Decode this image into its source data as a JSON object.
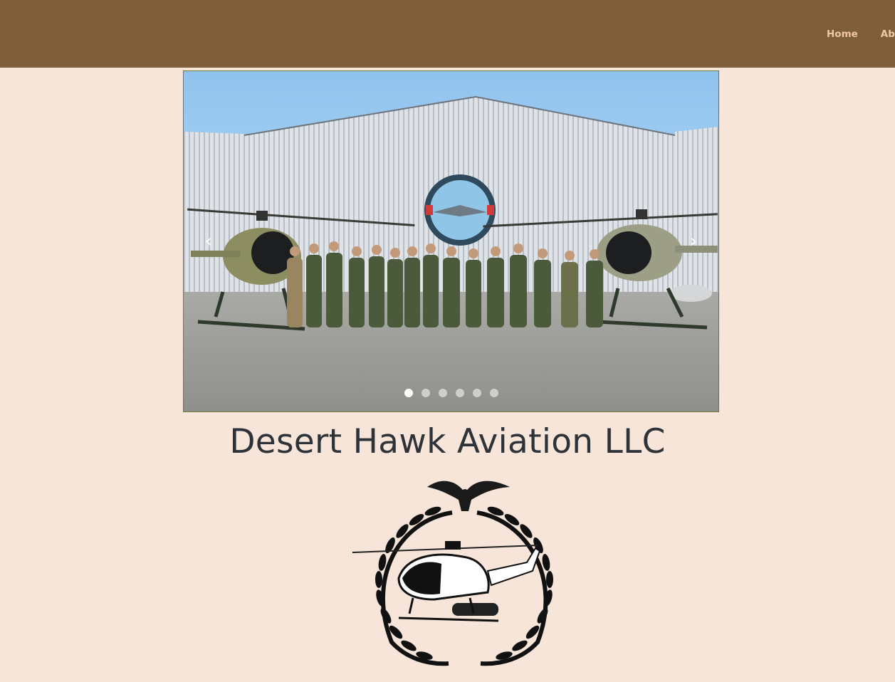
{
  "nav": {
    "items": [
      {
        "label": "Home"
      },
      {
        "label": "About"
      }
    ]
  },
  "carousel": {
    "prev_icon": "chevron-left-icon",
    "next_icon": "chevron-right-icon",
    "prev_glyph": "‹",
    "next_glyph": "›",
    "slide_count": 6,
    "active_slide": 1
  },
  "site": {
    "title": "Desert Hawk Aviation LLC"
  },
  "colors": {
    "header_bg": "#7f5f3a",
    "page_bg": "#f6e5d8",
    "nav_text": "#f0c9a2",
    "title_text": "#2d3338"
  }
}
